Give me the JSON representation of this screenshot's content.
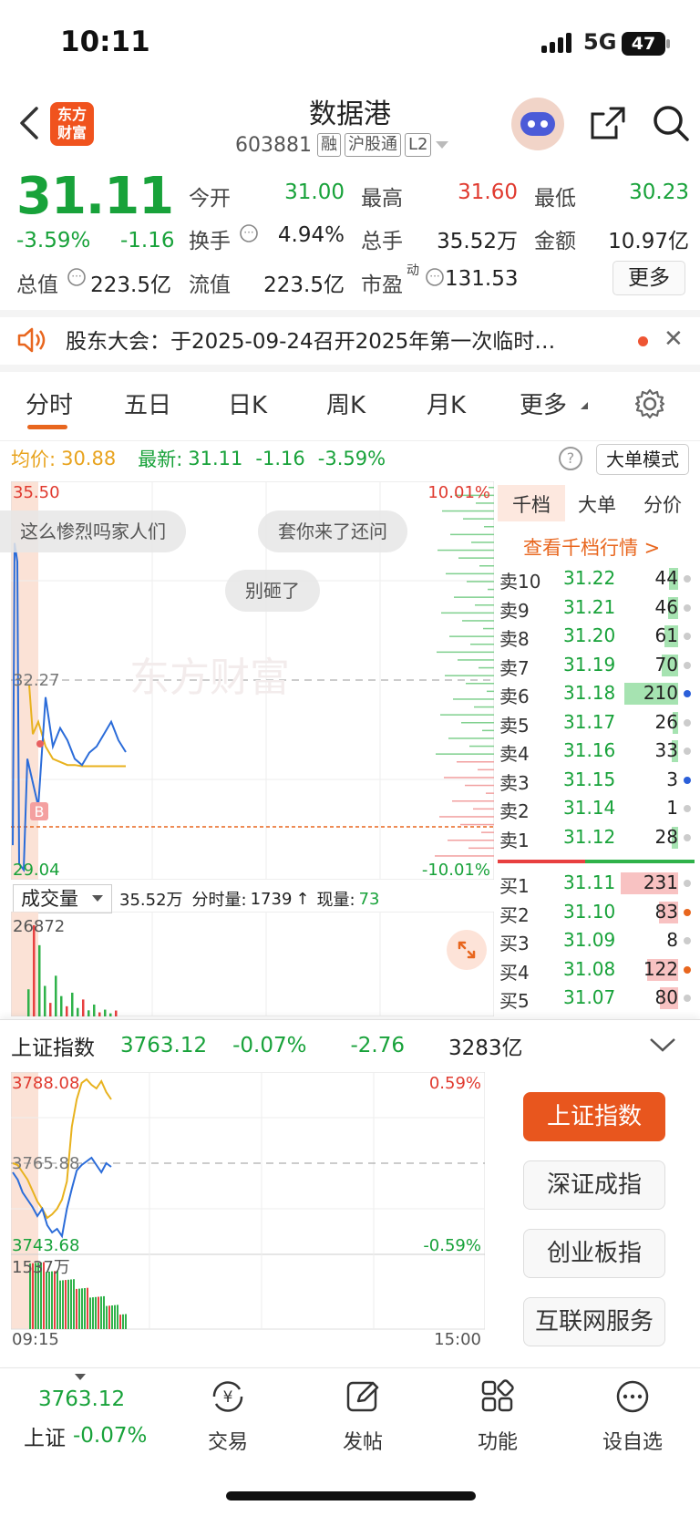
{
  "status_bar": {
    "time": "10:11",
    "network": "5G",
    "battery": "47"
  },
  "header": {
    "stock_name": "数据港",
    "stock_code": "603881",
    "tags": [
      "融",
      "沪股通",
      "L2"
    ],
    "logo_text": [
      "东方",
      "财富"
    ]
  },
  "quote": {
    "price": "31.11",
    "change_pct": "-3.59%",
    "change": "-1.16",
    "open_label": "今开",
    "open": "31.00",
    "high_label": "最高",
    "high": "31.60",
    "low_label": "最低",
    "low": "30.23",
    "turnover_label": "换手",
    "turnover": "4.94%",
    "volume_label": "总手",
    "volume": "35.52万",
    "amount_label": "金额",
    "amount": "10.97亿",
    "mktcap_label": "总值",
    "mktcap": "223.5亿",
    "float_label": "流值",
    "float": "223.5亿",
    "pe_label": "市盈",
    "pe_sup": "动",
    "pe": "131.53",
    "more_label": "更多"
  },
  "notice": {
    "text": "股东大会：于2025-09-24召开2025年第一次临时…"
  },
  "period_tabs": [
    "分时",
    "五日",
    "日K",
    "周K",
    "月K",
    "更多"
  ],
  "avg_bar": {
    "avg_label": "均价:",
    "avg": "30.88",
    "last_label": "最新:",
    "last": "31.11",
    "chg": "-1.16",
    "pct": "-3.59%",
    "help": "?",
    "bigorder_label": "大单模式"
  },
  "intraday": {
    "y_max": "35.50",
    "y_mid": "32.27",
    "y_min": "29.04",
    "pct_max": "10.01%",
    "pct_min": "-10.01%",
    "watermark": "东方财富",
    "b_marker": "B",
    "bubbles": [
      "这么惨烈吗家人们",
      "套你来了还问",
      "别砸了"
    ]
  },
  "chart_data": [
    {
      "type": "line",
      "title": "",
      "ylim": [
        29.04,
        35.5
      ],
      "series": [
        {
          "name": "",
          "values": [
            30.23,
            32.0,
            31.2,
            31.5,
            31.3,
            31.0,
            30.9,
            31.1,
            31.2,
            31.4,
            31.6,
            31.3,
            31.11
          ]
        },
        {
          "name": "均价",
          "values": [
            31.6,
            31.2,
            31.0,
            30.95,
            30.9,
            30.9,
            30.88,
            30.88,
            30.88,
            30.88,
            30.88,
            30.88,
            30.88
          ]
        }
      ]
    },
    {
      "type": "bar",
      "title": "",
      "ylim": [
        0,
        26872
      ],
      "values": [
        8000,
        26872,
        21000,
        9000,
        4000,
        12000,
        6000,
        3000,
        7000,
        2500,
        5000,
        1800,
        3500,
        1200,
        2000,
        900,
        1739
      ]
    }
  ],
  "volume_bar": {
    "select_label": "成交量",
    "total": "35.52万",
    "minute_label": "分时量:",
    "minute": "1739",
    "now_label": "现量:",
    "now": "73",
    "vol_max": "26872"
  },
  "orderbook": {
    "tabs": [
      "千档",
      "大单",
      "分价"
    ],
    "link": "查看千档行情 >",
    "asks": [
      {
        "label": "卖10",
        "price": "31.22",
        "vol": "44",
        "w": 0.07,
        "dot": "#cccccc"
      },
      {
        "label": "卖9",
        "price": "31.21",
        "vol": "46",
        "w": 0.08,
        "dot": "#cccccc"
      },
      {
        "label": "卖8",
        "price": "31.20",
        "vol": "61",
        "w": 0.11,
        "dot": "#cccccc"
      },
      {
        "label": "卖7",
        "price": "31.19",
        "vol": "70",
        "w": 0.13,
        "dot": "#cccccc"
      },
      {
        "label": "卖6",
        "price": "31.18",
        "vol": "210",
        "w": 0.42,
        "dot": "#2b5fd9"
      },
      {
        "label": "卖5",
        "price": "31.17",
        "vol": "26",
        "w": 0.04,
        "dot": "#cccccc"
      },
      {
        "label": "卖4",
        "price": "31.16",
        "vol": "33",
        "w": 0.05,
        "dot": "#cccccc"
      },
      {
        "label": "卖3",
        "price": "31.15",
        "vol": "3",
        "w": 0.0,
        "dot": "#2b5fd9"
      },
      {
        "label": "卖2",
        "price": "31.14",
        "vol": "1",
        "w": 0.0,
        "dot": "#cccccc"
      },
      {
        "label": "卖1",
        "price": "31.12",
        "vol": "28",
        "w": 0.05,
        "dot": "#cccccc"
      }
    ],
    "bids": [
      {
        "label": "买1",
        "price": "31.11",
        "vol": "231",
        "w": 0.45,
        "dot": "#cccccc"
      },
      {
        "label": "买2",
        "price": "31.10",
        "vol": "83",
        "w": 0.15,
        "dot": "#e8661e"
      },
      {
        "label": "买3",
        "price": "31.09",
        "vol": "8",
        "w": 0.0,
        "dot": "#cccccc"
      },
      {
        "label": "买4",
        "price": "31.08",
        "vol": "122",
        "w": 0.24,
        "dot": "#e8661e"
      },
      {
        "label": "买5",
        "price": "31.07",
        "vol": "80",
        "w": 0.14,
        "dot": "#cccccc"
      }
    ]
  },
  "index_panel": {
    "name": "上证指数",
    "value": "3763.12",
    "pct": "-0.07%",
    "chg": "-2.76",
    "amount": "3283亿",
    "y_max": "3788.08",
    "y_mid": "3765.88",
    "y_min": "3743.68",
    "pct_max": "0.59%",
    "pct_min": "-0.59%",
    "vol_max": "1537万",
    "t_start": "09:15",
    "t_end": "15:00",
    "buttons": [
      "上证指数",
      "深证成指",
      "创业板指",
      "互联网服务"
    ]
  },
  "bottom_nav": {
    "index_value": "3763.12",
    "index_name": "上证",
    "index_pct": "-0.07%",
    "items": [
      "交易",
      "发帖",
      "功能",
      "设自选"
    ]
  },
  "colors": {
    "up": "#e03a2f",
    "down": "#18a23a",
    "accent": "#e8661e"
  }
}
